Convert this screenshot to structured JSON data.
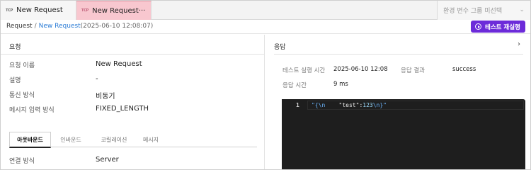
{
  "tabs": [
    {
      "method_tag": "TCP",
      "label": "New Request"
    },
    {
      "method_tag": "TCP",
      "label": "New Request···"
    }
  ],
  "env_select": {
    "placeholder": "환경 변수 그룹 미선택"
  },
  "breadcrumb": {
    "root": "Request",
    "separator": "/",
    "current": "New Request",
    "timestamp": "(2025-06-10 12:08:07)"
  },
  "run_button": {
    "label": "테스트 재실행"
  },
  "request": {
    "section_title": "요청",
    "fields": [
      {
        "label": "요청 이름",
        "value": "New Request"
      },
      {
        "label": "설명",
        "value": "-"
      },
      {
        "label": "통신 방식",
        "value": "비동기"
      },
      {
        "label": "메시지 입력 방식",
        "value": "FIXED_LENGTH"
      }
    ],
    "subtabs": [
      "아웃바운드",
      "인바운드",
      "코릴레이션",
      "메시지"
    ],
    "active_subtab": "아웃바운드",
    "connection": {
      "label": "연결 방식",
      "value": "Server"
    }
  },
  "response": {
    "section_title": "응답",
    "run_time": {
      "label": "테스트 실행 시간",
      "value": "2025-06-10 12:08"
    },
    "result": {
      "label": "응답 결과",
      "value": "success"
    },
    "response_time": {
      "label": "응답 시간",
      "value": "9 ms"
    },
    "code": {
      "line_number": "1",
      "open": "\"{\\n",
      "key": "\"test\"",
      "colon": ":",
      "number": "123",
      "close": "\\n}\""
    }
  },
  "colors": {
    "accent": "#6c2bd9",
    "active_tab": "#f8c7cf",
    "link": "#2a7bd5",
    "code_bg": "#1e1e1e"
  }
}
